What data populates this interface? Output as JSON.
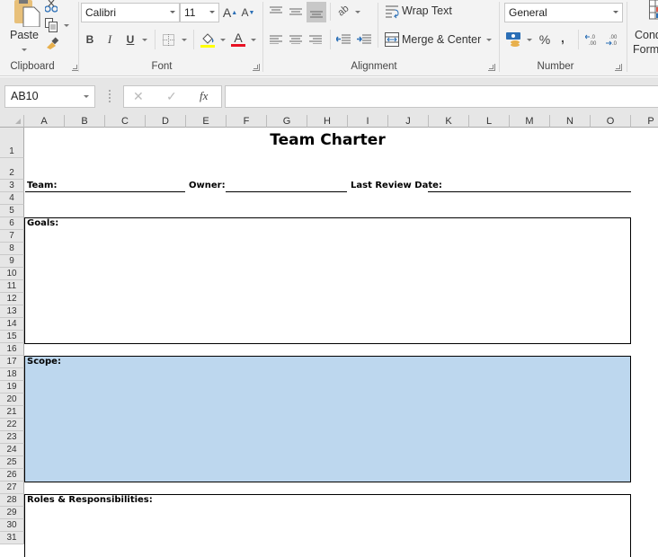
{
  "ribbon": {
    "clipboard": {
      "label": "Clipboard",
      "paste_label": "Paste"
    },
    "font": {
      "label": "Font",
      "font_name": "Calibri",
      "font_size": "11",
      "bold": "B",
      "italic": "I",
      "underline": "U",
      "grow_font": "A",
      "shrink_font": "A",
      "font_color": "A",
      "highlight_color": "#ffff00",
      "text_color": "#e81123"
    },
    "alignment": {
      "label": "Alignment",
      "wrap_text": "Wrap Text",
      "merge_center": "Merge & Center"
    },
    "number": {
      "label": "Number",
      "format": "General",
      "percent": "%",
      "comma": ",",
      "increase_decimal": "←.0 .00",
      "decrease_decimal": ".00 →.0"
    },
    "styles": {
      "conditional_formatting_line1": "Cond",
      "conditional_formatting_line2": "Form"
    }
  },
  "formula_bar": {
    "name_box": "AB10",
    "cancel": "✕",
    "enter": "✓",
    "fx": "fx",
    "formula": ""
  },
  "columns": [
    "A",
    "B",
    "C",
    "D",
    "E",
    "F",
    "G",
    "H",
    "I",
    "J",
    "K",
    "L",
    "M",
    "N",
    "O",
    "P"
  ],
  "rows": [
    "1",
    "2",
    "3",
    "4",
    "5",
    "6",
    "7",
    "8",
    "9",
    "10",
    "11",
    "12",
    "13",
    "14",
    "15",
    "16",
    "17",
    "18",
    "19",
    "20",
    "21",
    "22",
    "23",
    "24",
    "25",
    "26",
    "27",
    "28",
    "29",
    "30",
    "31"
  ],
  "sheet": {
    "title": "Team Charter",
    "team_label": "Team:",
    "owner_label": "Owner:",
    "review_label": "Last Review Date:",
    "goals_label": "Goals:",
    "scope_label": "Scope:",
    "roles_label": "Roles & Responsibilities:",
    "scope_fill": "#bdd7ee"
  }
}
